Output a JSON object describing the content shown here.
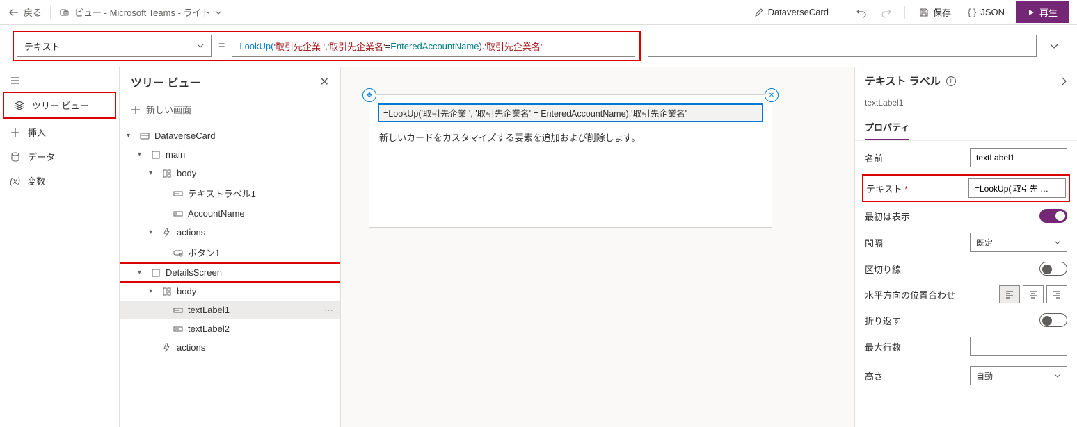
{
  "topbar": {
    "back": "戻る",
    "title": "ビュー - Microsoft Teams - ライト",
    "dataverse": "DataverseCard",
    "save": "保存",
    "json": "JSON",
    "play": "再生"
  },
  "formula": {
    "property": "テキスト",
    "text_parts": [
      "LookUp(",
      "'取引先企業 '",
      ", ",
      "'取引先企業名'",
      " = ",
      "EnteredAccountName",
      ").",
      "'取引先企業名'"
    ]
  },
  "leftrail": {
    "tree": "ツリー ビュー",
    "insert": "挿入",
    "data": "データ",
    "vars": "変数"
  },
  "treepanel": {
    "title": "ツリー ビュー",
    "newscreen": "新しい画面",
    "nodes": {
      "dataverseCard": "DataverseCard",
      "main": "main",
      "body1": "body",
      "textlabel1": "テキストラベル1",
      "accountName": "AccountName",
      "actions1": "actions",
      "button1": "ボタン1",
      "detailsScreen": "DetailsScreen",
      "body2": "body",
      "textLabel1b": "textLabel1",
      "textLabel2": "textLabel2",
      "actions2": "actions"
    }
  },
  "canvas": {
    "field": "=LookUp('取引先企業 ', '取引先企業名' = EnteredAccountName).'取引先企業名'",
    "hint": "新しいカードをカスタマイズする要素を追加および削除します。"
  },
  "props": {
    "title": "テキスト ラベル",
    "subtitle": "textLabel1",
    "tab": "プロパティ",
    "rows": {
      "name_lbl": "名前",
      "name_val": "textLabel1",
      "text_lbl": "テキスト",
      "text_val": "=LookUp('取引先 …",
      "visible_lbl": "最初は表示",
      "spacing_lbl": "間隔",
      "spacing_val": "既定",
      "divider_lbl": "区切り線",
      "halign_lbl": "水平方向の位置合わせ",
      "wrap_lbl": "折り返す",
      "maxlines_lbl": "最大行数",
      "height_lbl": "高さ",
      "height_val": "自動"
    }
  }
}
